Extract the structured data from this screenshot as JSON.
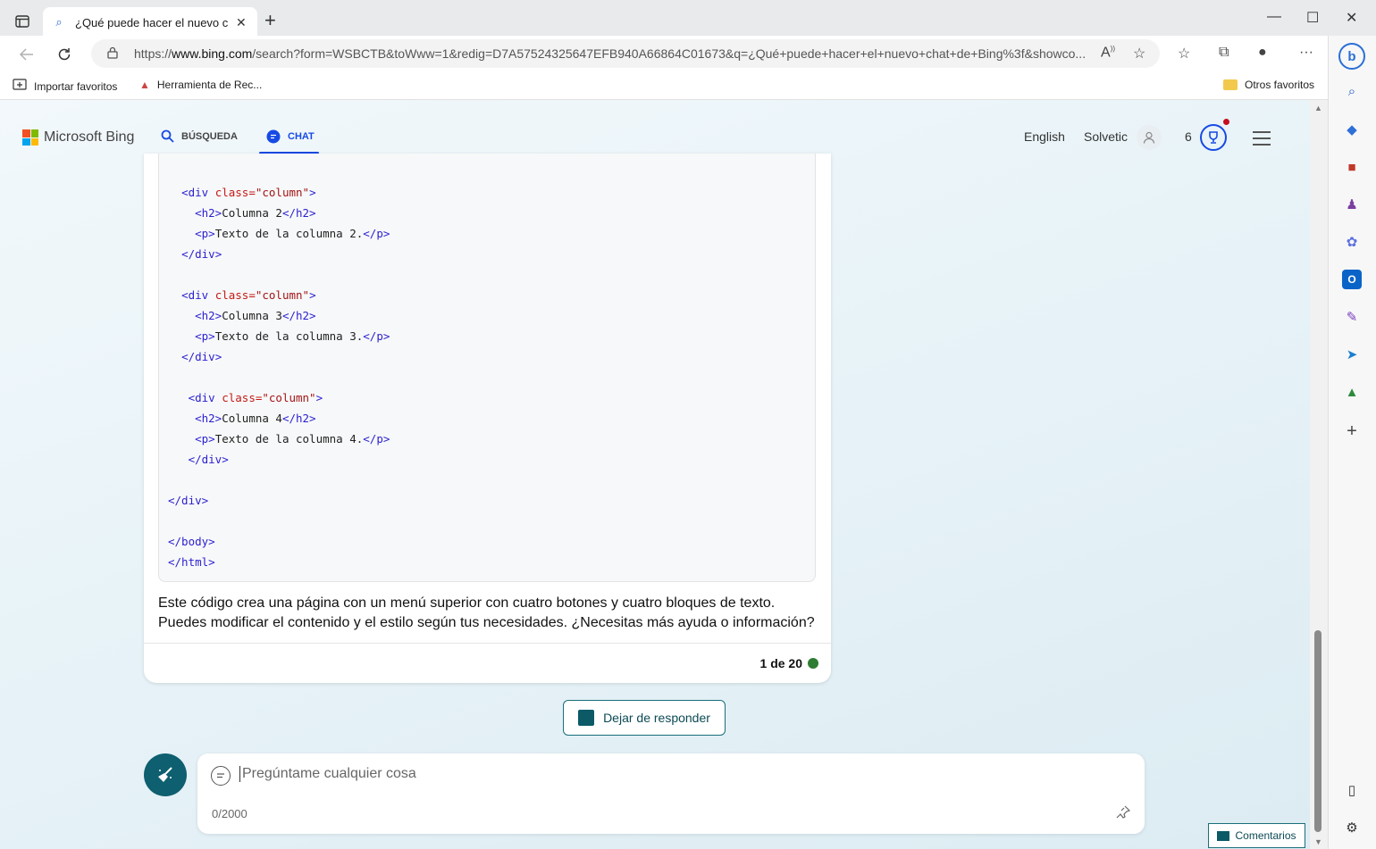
{
  "browser": {
    "tab_title": "¿Qué puede hacer el nuevo chat",
    "tab_close": "✕",
    "new_tab": "+",
    "url_prefix": "https://",
    "url_host": "www.bing.com",
    "url_rest": "/search?form=WSBCTB&toWww=1&redig=D7A57524325647EFB940A66864C01673&q=¿Qué+puede+hacer+el+nuevo+chat+de+Bing%3f&showco...",
    "window_controls": {
      "minimize": "—",
      "maximize": "☐",
      "close": "✕"
    }
  },
  "favorites_bar": {
    "items": [
      "Importar favoritos",
      "Herramienta de Rec..."
    ],
    "other": "Otros favoritos"
  },
  "bing_header": {
    "logo_text": "Microsoft Bing",
    "nav_search": "BÚSQUEDA",
    "nav_chat": "CHAT",
    "language": "English",
    "user_name": "Solvetic",
    "rewards_count": "6"
  },
  "code_lines": [
    {
      "indent": "  ",
      "open": "<div ",
      "attr": "class=",
      "str": "\"column\"",
      "close": ">",
      "text": ""
    },
    {
      "indent": "    ",
      "open": "<h2>",
      "attr": "",
      "str": "",
      "close": "</h2>",
      "text": "Columna 2"
    },
    {
      "indent": "    ",
      "open": "<p>",
      "attr": "",
      "str": "",
      "close": "</p>",
      "text": "Texto de la columna 2."
    },
    {
      "indent": "  ",
      "open": "</div>",
      "attr": "",
      "str": "",
      "close": "",
      "text": ""
    },
    {
      "indent": "",
      "open": "",
      "attr": "",
      "str": "",
      "close": "",
      "text": ""
    },
    {
      "indent": "  ",
      "open": "<div ",
      "attr": "class=",
      "str": "\"column\"",
      "close": ">",
      "text": ""
    },
    {
      "indent": "    ",
      "open": "<h2>",
      "attr": "",
      "str": "",
      "close": "</h2>",
      "text": "Columna 3"
    },
    {
      "indent": "    ",
      "open": "<p>",
      "attr": "",
      "str": "",
      "close": "</p>",
      "text": "Texto de la columna 3."
    },
    {
      "indent": "  ",
      "open": "</div>",
      "attr": "",
      "str": "",
      "close": "",
      "text": ""
    },
    {
      "indent": "",
      "open": "",
      "attr": "",
      "str": "",
      "close": "",
      "text": ""
    },
    {
      "indent": "   ",
      "open": "<div ",
      "attr": "class=",
      "str": "\"column\"",
      "close": ">",
      "text": ""
    },
    {
      "indent": "    ",
      "open": "<h2>",
      "attr": "",
      "str": "",
      "close": "</h2>",
      "text": "Columna 4"
    },
    {
      "indent": "    ",
      "open": "<p>",
      "attr": "",
      "str": "",
      "close": "</p>",
      "text": "Texto de la columna 4."
    },
    {
      "indent": "   ",
      "open": "</div>",
      "attr": "",
      "str": "",
      "close": "",
      "text": ""
    },
    {
      "indent": "",
      "open": "",
      "attr": "",
      "str": "",
      "close": "",
      "text": ""
    },
    {
      "indent": "",
      "open": "</div>",
      "attr": "",
      "str": "",
      "close": "",
      "text": ""
    },
    {
      "indent": "",
      "open": "",
      "attr": "",
      "str": "",
      "close": "",
      "text": ""
    },
    {
      "indent": "",
      "open": "</body>",
      "attr": "",
      "str": "",
      "close": "",
      "text": ""
    },
    {
      "indent": "",
      "open": "</html>",
      "attr": "",
      "str": "",
      "close": "",
      "text": ""
    }
  ],
  "message": {
    "text": "Este código crea una página con un menú superior con cuatro botones y cuatro bloques de texto. Puedes modificar el contenido y el estilo según tus necesidades. ¿Necesitas más ayuda o información?",
    "counter": "1 de 20"
  },
  "stop_button": "Dejar de responder",
  "input": {
    "placeholder": "Pregúntame cualquier cosa",
    "char_count": "0/2000"
  },
  "feedback_button": "Comentarios",
  "colors": {
    "accent_blue": "#174ae4",
    "teal": "#0e5f6f",
    "status_green": "#2e7d32"
  }
}
